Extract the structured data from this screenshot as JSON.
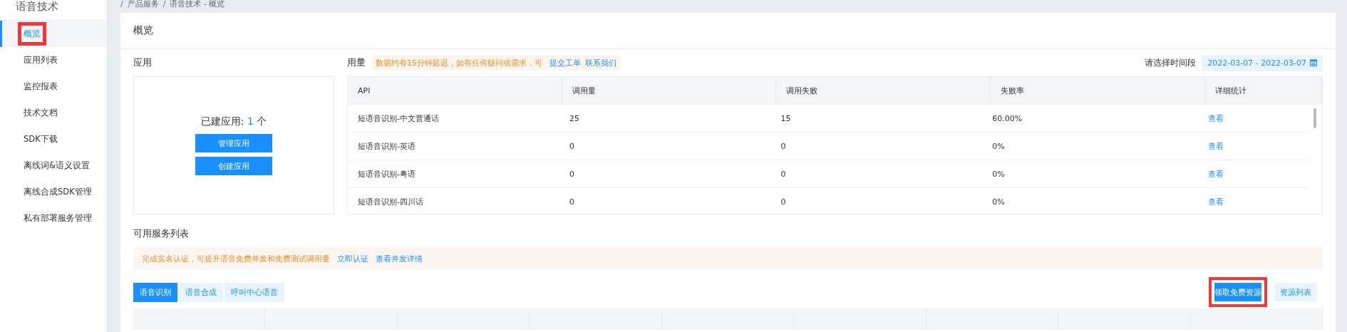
{
  "breadcrumb_separator": "/",
  "breadcrumb": [
    "产品服务",
    "语音技术 - 概览"
  ],
  "sidebar": {
    "title": "语音技术",
    "items": [
      {
        "label": "概览",
        "selected": true,
        "highlighted": true
      },
      {
        "label": "应用列表",
        "selected": false,
        "highlighted": false
      },
      {
        "label": "监控报表",
        "selected": false,
        "highlighted": false
      },
      {
        "label": "技术文档",
        "selected": false,
        "highlighted": false
      },
      {
        "label": "SDK下载",
        "selected": false,
        "highlighted": false
      },
      {
        "label": "离线词&语义设置",
        "selected": false,
        "highlighted": false
      },
      {
        "label": "离线合成SDK管理",
        "selected": false,
        "highlighted": false
      },
      {
        "label": "私有部署服务管理",
        "selected": false,
        "highlighted": false
      }
    ]
  },
  "page_title": "概览",
  "apps": {
    "title": "应用",
    "count_label": "已建应用:",
    "count": "1",
    "unit": "个",
    "buttons": [
      "管理应用",
      "创建应用"
    ]
  },
  "usage": {
    "title": "用量",
    "notice": "数据约有15分钟延迟，如有任何疑问或需求，可",
    "notice_links": [
      "提交工单",
      "联系我们"
    ],
    "date_label": "请选择时间段",
    "date_range": "2022-03-07 - 2022-03-07",
    "table": {
      "columns": [
        "API",
        "调用量",
        "调用失败",
        "失败率",
        "详细统计"
      ],
      "rows": [
        [
          "短语音识别-中文普通话",
          "25",
          "15",
          "60.00%",
          "查看"
        ],
        [
          "短语音识别-英语",
          "0",
          "0",
          "0%",
          "查看"
        ],
        [
          "短语音识别-粤语",
          "0",
          "0",
          "0%",
          "查看"
        ],
        [
          "短语音识别-四川话",
          "0",
          "0",
          "0%",
          "查看"
        ]
      ]
    }
  },
  "services": {
    "title": "可用服务列表",
    "notice": "完成实名认证，可提升语音免费并发和免费测试调用量",
    "notice_links": [
      "立即认证",
      "查看并发详情"
    ],
    "tabs": [
      {
        "label": "语音识别",
        "selected": true
      },
      {
        "label": "语音合成",
        "selected": false
      },
      {
        "label": "呼叫中心语音",
        "selected": false
      }
    ],
    "buttons": [
      {
        "label": "领取免费资源",
        "kind": "primary",
        "highlighted": true
      },
      {
        "label": "资源列表",
        "kind": "secondary",
        "highlighted": false
      }
    ]
  }
}
